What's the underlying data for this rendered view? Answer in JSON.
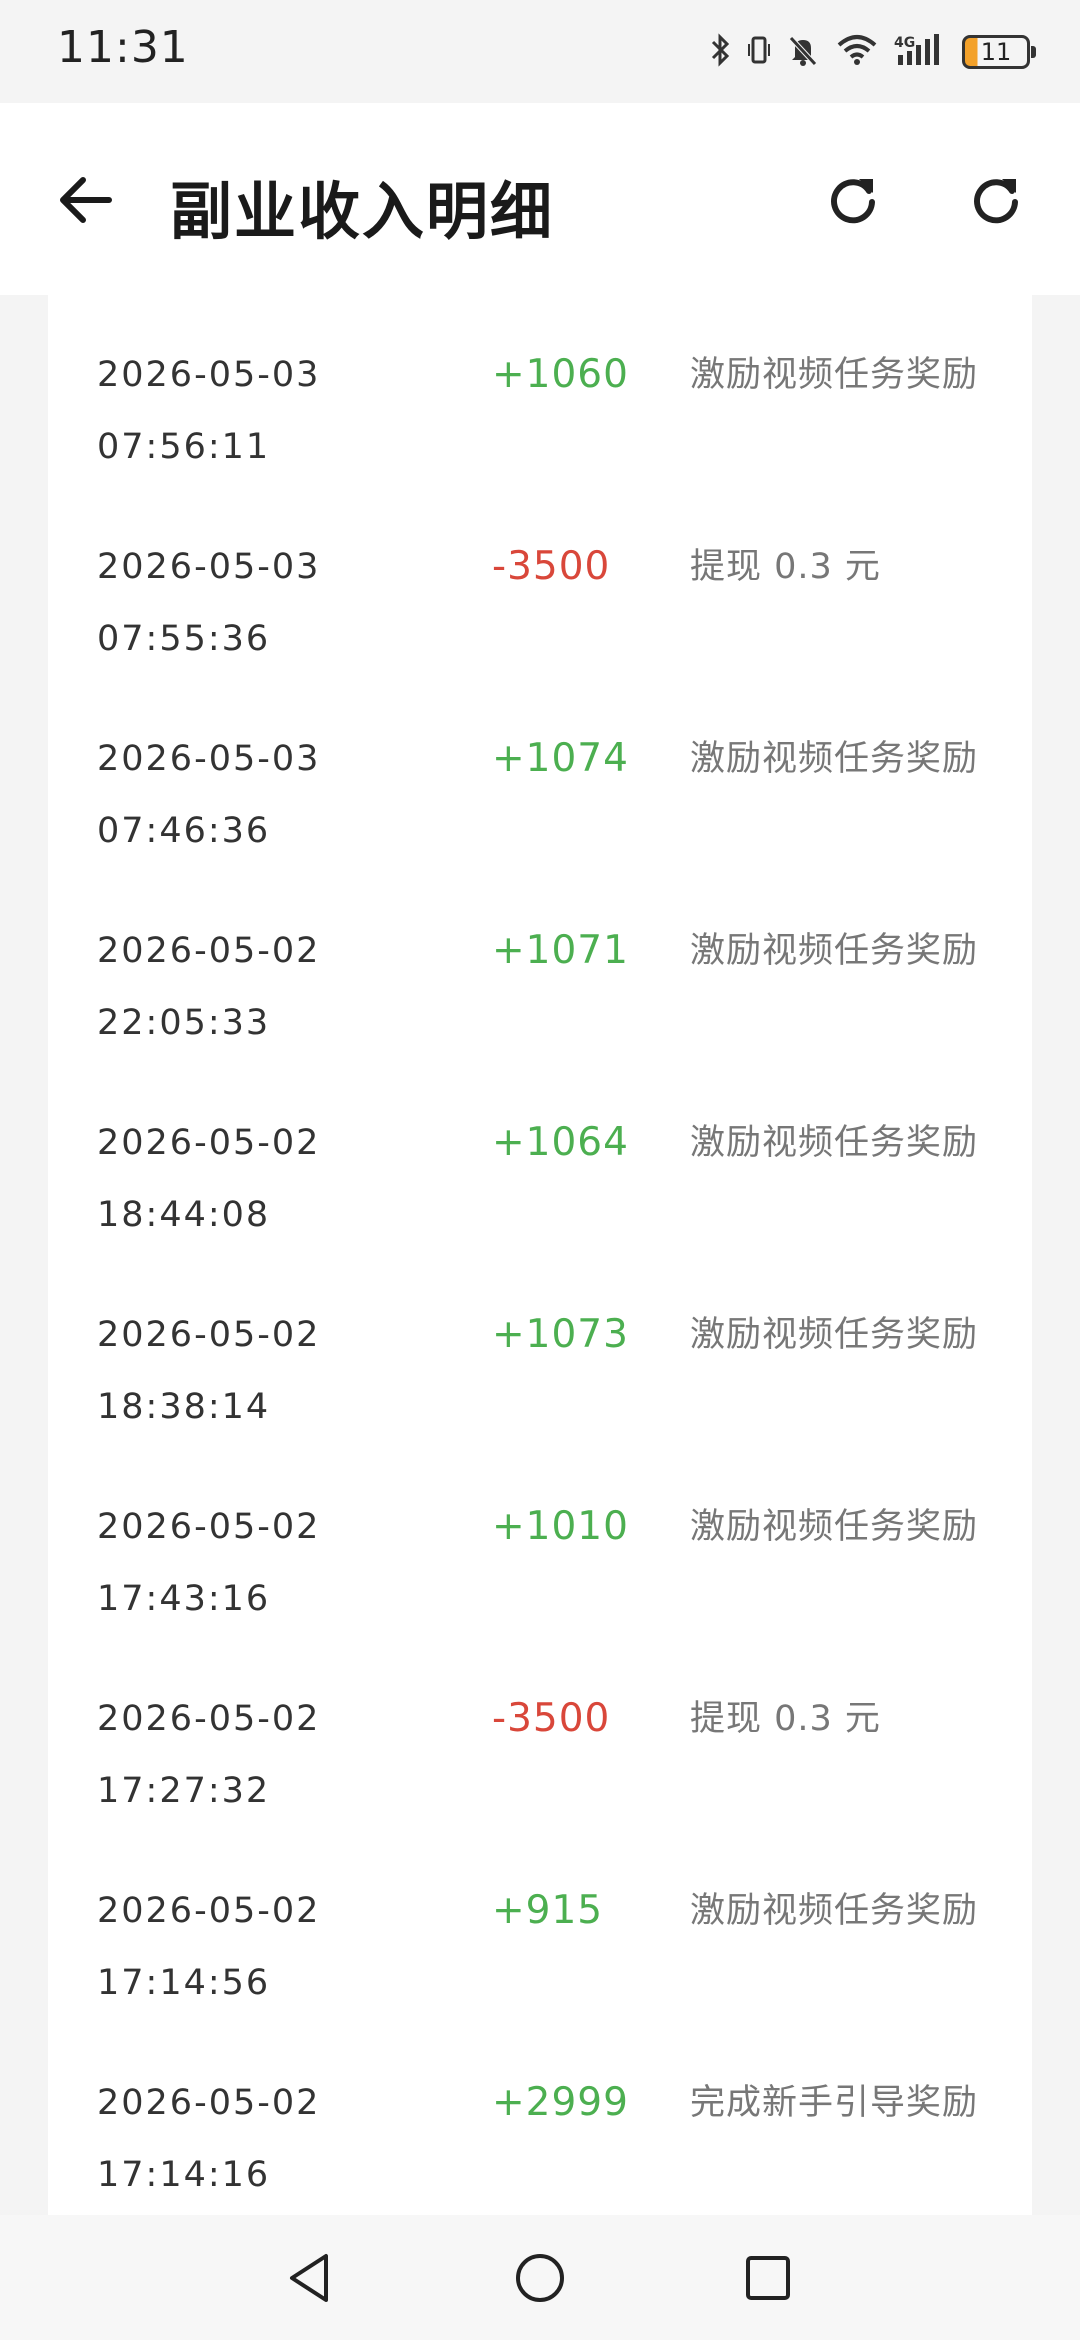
{
  "status_bar": {
    "time": "11:31",
    "battery_level": "11",
    "icons": [
      "bluetooth-icon",
      "vibrate-icon",
      "mute-icon",
      "wifi-icon",
      "4g-signal-icon",
      "battery-icon"
    ]
  },
  "header": {
    "title": "副业收入明细",
    "back_icon": "arrow-left-icon",
    "action_icons": [
      "refresh-icon",
      "refresh-icon"
    ]
  },
  "colors": {
    "positive": "#4caf50",
    "negative": "#d9473a",
    "text_primary": "#333333",
    "text_secondary": "#777777"
  },
  "records": [
    {
      "date": "2026-05-03",
      "time": "07:56:11",
      "amount": "+1060",
      "type": "pos",
      "desc": "激励视频任务奖励"
    },
    {
      "date": "2026-05-03",
      "time": "07:55:36",
      "amount": "-3500",
      "type": "neg",
      "desc": "提现 0.3 元"
    },
    {
      "date": "2026-05-03",
      "time": "07:46:36",
      "amount": "+1074",
      "type": "pos",
      "desc": "激励视频任务奖励"
    },
    {
      "date": "2026-05-02",
      "time": "22:05:33",
      "amount": "+1071",
      "type": "pos",
      "desc": "激励视频任务奖励"
    },
    {
      "date": "2026-05-02",
      "time": "18:44:08",
      "amount": "+1064",
      "type": "pos",
      "desc": "激励视频任务奖励"
    },
    {
      "date": "2026-05-02",
      "time": "18:38:14",
      "amount": "+1073",
      "type": "pos",
      "desc": "激励视频任务奖励"
    },
    {
      "date": "2026-05-02",
      "time": "17:43:16",
      "amount": "+1010",
      "type": "pos",
      "desc": "激励视频任务奖励"
    },
    {
      "date": "2026-05-02",
      "time": "17:27:32",
      "amount": "-3500",
      "type": "neg",
      "desc": "提现 0.3 元"
    },
    {
      "date": "2026-05-02",
      "time": "17:14:56",
      "amount": "+915",
      "type": "pos",
      "desc": "激励视频任务奖励"
    },
    {
      "date": "2026-05-02",
      "time": "17:14:16",
      "amount": "+2999",
      "type": "pos",
      "desc": "完成新手引导奖励"
    }
  ],
  "nav_bar": {
    "buttons": [
      "nav-back-icon",
      "nav-home-icon",
      "nav-recent-icon"
    ]
  }
}
